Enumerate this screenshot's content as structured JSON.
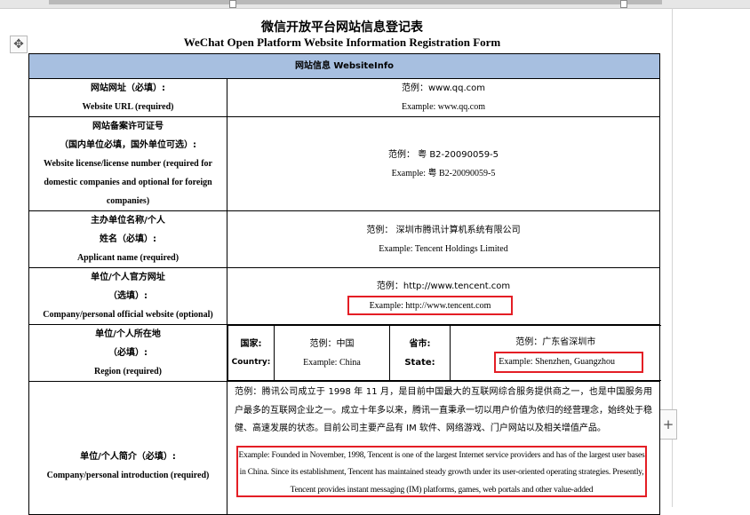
{
  "title_cn": "微信开放平台网站信息登记表",
  "title_en": "WeChat Open Platform Website Information Registration Form",
  "section_header": "网站信息 WebsiteInfo",
  "rows": {
    "url": {
      "label_cn": "网站网址（必填）:",
      "label_en": "Website URL (required)",
      "example_cn": "范例：www.qq.com",
      "example_en": "Example: www.qq.com"
    },
    "license": {
      "label_cn1": "网站备案许可证号",
      "label_cn2": "（国内单位必填，国外单位可选）:",
      "label_en1": "Website license/license number (required for",
      "label_en2": "domestic companies and optional for foreign",
      "label_en3": "companies)",
      "example_cn": "范例：  粤 B2-20090059-5",
      "example_en": "Example:  粤 B2-20090059-5"
    },
    "applicant": {
      "label_cn1": "主办单位名称/个人",
      "label_cn2": "姓名（必填）:",
      "label_en": "Applicant name (required)",
      "example_cn": "范例：  深圳市腾讯计算机系统有限公司",
      "example_en": "Example: Tencent Holdings Limited"
    },
    "website": {
      "label_cn1": "单位/个人官方网址",
      "label_cn2": "（选填）:",
      "label_en": "Company/personal official website (optional)",
      "example_cn": "范例：http://www.tencent.com",
      "example_en": "Example: http://www.tencent.com"
    },
    "region": {
      "label_cn1": "单位/个人所在地",
      "label_cn2": "（必填）:",
      "label_en": "Region (required)",
      "country_cn": "国家:",
      "country_en": "Country:",
      "country_example_cn": "范例：中国",
      "country_example_en": "Example: China",
      "state_cn": "省市:",
      "state_en": "State:",
      "state_example_cn": "范例：广东省深圳市",
      "state_example_en": "Example: Shenzhen, Guangzhou"
    },
    "intro": {
      "label_cn": "单位/个人简介（必填）:",
      "label_en": "Company/personal introduction (required)",
      "example_cn": "范例：腾讯公司成立于 1998 年 11 月，是目前中国最大的互联网综合服务提供商之一，也是中国服务用户最多的互联网企业之一。成立十年多以来，腾讯一直秉承一切以用户价值为依归的经营理念，始终处于稳健、高速发展的状态。目前公司主要产品有 IM 软件、网络游戏、门户网站以及相关增值产品。",
      "example_en": "Example: Founded in November, 1998, Tencent is one of the largest Internet service providers and has of the largest user bases in China. Since its establishment, Tencent has maintained steady growth under its user-oriented operating strategies. Presently, Tencent provides instant messaging (IM) platforms, games, web portals and other value-added"
    }
  },
  "icons": {
    "move": "move-arrows-icon",
    "add": "plus-icon"
  },
  "colors": {
    "header_bg": "#a7bfe0",
    "highlight": "#e41e25"
  }
}
